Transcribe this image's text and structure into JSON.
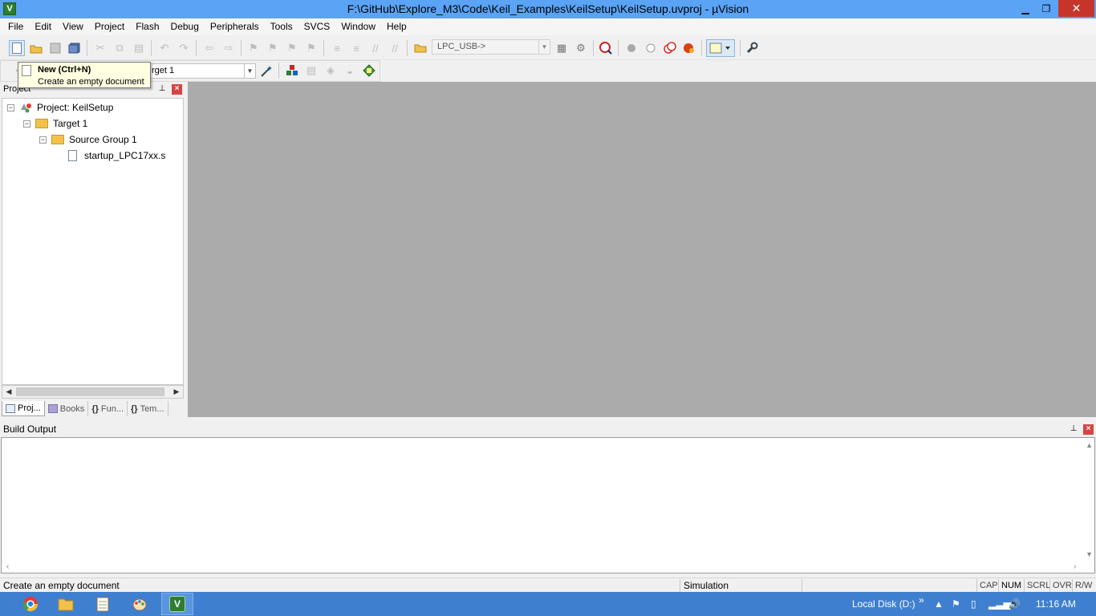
{
  "window": {
    "title": "F:\\GitHub\\Explore_M3\\Code\\Keil_Examples\\KeilSetup\\KeilSetup.uvproj - µVision",
    "app_icon_letter": "V",
    "minimize": "▁",
    "maximize": "❐",
    "close": "✕"
  },
  "menu": [
    "File",
    "Edit",
    "View",
    "Project",
    "Flash",
    "Debug",
    "Peripherals",
    "Tools",
    "SVCS",
    "Window",
    "Help"
  ],
  "toolbar": {
    "target_combo": "LPC_USB->"
  },
  "build_toolbar": {
    "target_combo": "rget 1"
  },
  "tooltip": {
    "title": "New (Ctrl+N)",
    "description": "Create an empty document"
  },
  "project_panel": {
    "title": "Project",
    "tree": {
      "project": "Project: KeilSetup",
      "target": "Target 1",
      "group": "Source Group 1",
      "file": "startup_LPC17xx.s"
    },
    "tabs": [
      "Proj...",
      "Books",
      "Fun...",
      "Tem..."
    ]
  },
  "build_output": {
    "title": "Build Output"
  },
  "statusbar": {
    "message": "Create an empty document",
    "mode": "Simulation",
    "indicators": [
      "CAP",
      "NUM",
      "SCRL",
      "OVR",
      "R/W"
    ]
  },
  "taskbar": {
    "drive": "Local Disk (D:)",
    "chevron": "»",
    "time": "11:16 AM"
  },
  "colors": {
    "titlebar": "#5aa3f5",
    "taskbar": "#3f7fd0",
    "editor_bg": "#ababab",
    "close_red": "#c7352a"
  }
}
